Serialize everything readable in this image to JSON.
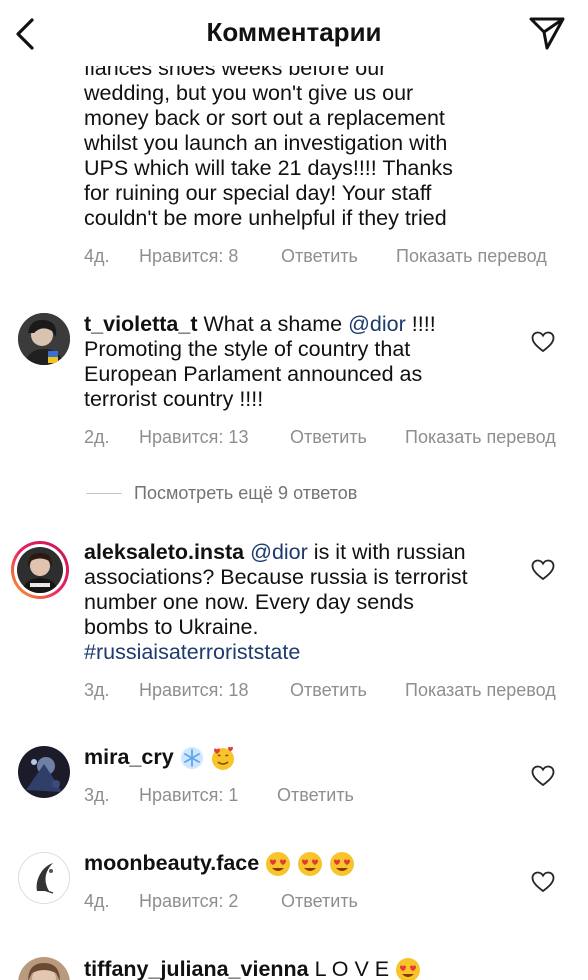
{
  "header": {
    "title": "Комментарии"
  },
  "comments": [
    {
      "username": "",
      "text_lines": [
        "fiances shoes weeks before our",
        "wedding, but you won't give us our",
        "money back or sort out a replacement",
        "whilst you launch an investigation with",
        "UPS which will take 21 days!!!! Thanks",
        "for ruining our special day! Your staff",
        "couldn't be more unhelpful if they tried"
      ],
      "time": "4д.",
      "likes": "Нравится: 8",
      "reply": "Ответить",
      "translate": "Показать перевод"
    },
    {
      "username": "t_violetta_t",
      "text_a": "What a shame",
      "mention": "@dior",
      "text_b": "!!!!",
      "text_lines": [
        "Promoting the style of country that",
        "European Parlament announced as",
        "terrorist country !!!!"
      ],
      "time": "2д.",
      "likes": "Нравится: 13",
      "reply": "Ответить",
      "translate": "Показать перевод"
    },
    {
      "username": "aleksaleto.insta",
      "mention": "@dior",
      "text_a": "is it with russian",
      "text_lines": [
        "associations? Because russia is terrorist",
        "number one now. Every day sends",
        "bombs to Ukraine."
      ],
      "hashtag": "#russiaisaterroriststate",
      "time": "3д.",
      "likes": "Нравится: 18",
      "reply": "Ответить",
      "translate": "Показать перевод"
    },
    {
      "username": "mira_cry",
      "time": "3д.",
      "likes": "Нравится: 1",
      "reply": "Ответить"
    },
    {
      "username": "moonbeauty.face",
      "time": "4д.",
      "likes": "Нравится: 2",
      "reply": "Ответить"
    },
    {
      "username": "tiffany_juliana_vienna",
      "text": "L O V E"
    }
  ],
  "view_more_replies": "Посмотреть ещё 9 ответов",
  "colors": {
    "link": "#1e3a6e",
    "meta": "#8e8e8e",
    "story_ring_start": "#f9a825",
    "story_ring_end": "#c2185b"
  },
  "icons": [
    "back-arrow-icon",
    "paper-plane-icon",
    "heart-outline-icon",
    "snowflake-emoji",
    "smiling-face-with-hearts-emoji",
    "heart-eyes-emoji"
  ]
}
